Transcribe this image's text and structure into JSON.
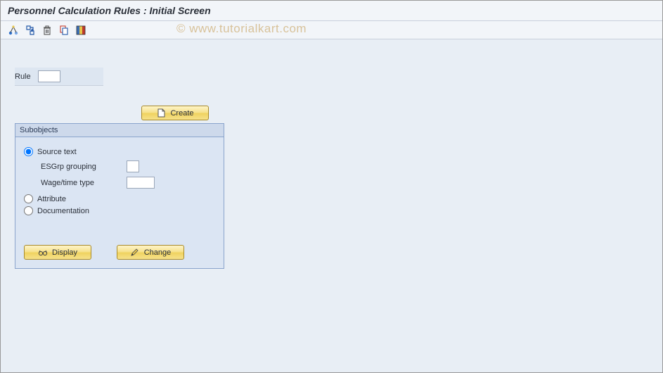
{
  "title": "Personnel Calculation Rules : Initial Screen",
  "toolbar_icons": [
    "hierarchy",
    "reference",
    "delete",
    "copy",
    "layout"
  ],
  "watermark": "© www.tutorialkart.com",
  "fields": {
    "rule_label": "Rule",
    "rule_value": ""
  },
  "buttons": {
    "create": "Create",
    "display": "Display",
    "change": "Change"
  },
  "group": {
    "title": "Subobjects",
    "source_text": "Source text",
    "esg_label": "ESGrp grouping",
    "esg_value": "",
    "wage_label": "Wage/time type",
    "wage_value": "",
    "attribute": "Attribute",
    "documentation": "Documentation",
    "selected": "source_text"
  }
}
